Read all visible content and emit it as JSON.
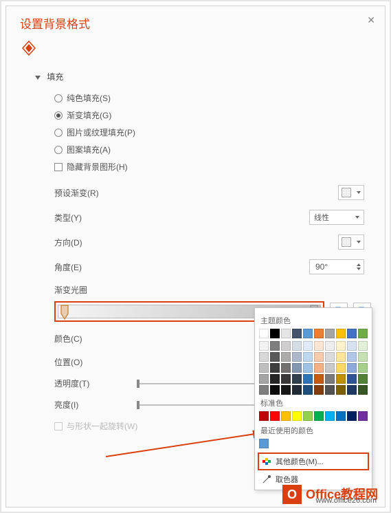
{
  "panel": {
    "title": "设置背景格式",
    "section_fill": "填充",
    "radios": {
      "solid": "纯色填充(S)",
      "gradient": "渐变填充(G)",
      "picture": "图片或纹理填充(P)",
      "pattern": "图案填充(A)"
    },
    "hide_bg": "隐藏背景图形(H)",
    "preset": "预设渐变(R)",
    "type": "类型(Y)",
    "type_value": "线性",
    "direction": "方向(D)",
    "angle": "角度(E)",
    "angle_value": "90°",
    "stops": "渐变光圈",
    "color_label": "颜色(C)",
    "position": "位置(O)",
    "transparency": "透明度(T)",
    "brightness": "亮度(I)",
    "rotate_with_shape": "与形状一起旋转(W)"
  },
  "picker": {
    "theme": "主题颜色",
    "standard": "标准色",
    "recent": "最近使用的颜色",
    "more": "其他颜色(M)...",
    "eyedropper": "取色器"
  },
  "watermark": {
    "brand": "Office教程网",
    "url": "www.office26.com"
  },
  "colors": {
    "theme_row1": [
      "#ffffff",
      "#000000",
      "#e7e6e6",
      "#44546a",
      "#5b9bd5",
      "#ed7d31",
      "#a5a5a5",
      "#ffc000",
      "#4472c4",
      "#70ad47"
    ],
    "theme_tints": [
      [
        "#f2f2f2",
        "#7f7f7f",
        "#d0cece",
        "#d6dce4",
        "#deebf6",
        "#fbe5d5",
        "#ededed",
        "#fff2cc",
        "#d9e2f3",
        "#e2efd9"
      ],
      [
        "#d8d8d8",
        "#595959",
        "#aeabab",
        "#adb9ca",
        "#bdd7ee",
        "#f7cbac",
        "#dbdbdb",
        "#fee599",
        "#b4c6e7",
        "#c5e0b3"
      ],
      [
        "#bfbfbf",
        "#3f3f3f",
        "#757070",
        "#8496b0",
        "#9cc3e5",
        "#f4b183",
        "#c9c9c9",
        "#ffd965",
        "#8eaadb",
        "#a8d08d"
      ],
      [
        "#a5a5a5",
        "#262626",
        "#3a3838",
        "#323f4f",
        "#2e75b5",
        "#c55a11",
        "#7b7b7b",
        "#bf9000",
        "#2f5496",
        "#538135"
      ],
      [
        "#7f7f7f",
        "#0c0c0c",
        "#171616",
        "#222a35",
        "#1e4e79",
        "#833c0b",
        "#525252",
        "#7f6000",
        "#1f3864",
        "#375623"
      ]
    ],
    "standard": [
      "#c00000",
      "#ff0000",
      "#ffc000",
      "#ffff00",
      "#92d050",
      "#00b050",
      "#00b0f0",
      "#0070c0",
      "#002060",
      "#7030a0"
    ],
    "recent": [
      "#5b9bd5"
    ]
  }
}
